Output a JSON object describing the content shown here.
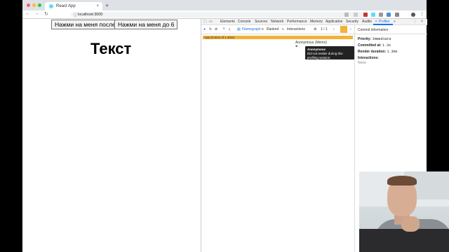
{
  "browser": {
    "tab_title": "React App",
    "tab_close": "×",
    "new_tab": "+",
    "url": "localhost:3000",
    "back": "←",
    "forward": "→",
    "reload": "↻"
  },
  "page": {
    "button_after": "Нажми на меня после",
    "button_before": "Нажми на меня до 6",
    "heading": "Текст"
  },
  "devtools": {
    "tabs": [
      "Elements",
      "Console",
      "Sources",
      "Network",
      "Performance",
      "Memory",
      "Application",
      "Security",
      "Audits",
      "⚛ Profiler"
    ],
    "more": "»",
    "close": "×",
    "toolbar": {
      "flamegraph": "Flamegraph",
      "ranked": "Ranked",
      "interactions": "Interactions",
      "commit_counter": "1 / 1",
      "prev": "‹",
      "next": "›"
    },
    "flame": {
      "app_bar": "App (0.5ms of 1.3ms)",
      "anonymous": "Anonymous (Memo)"
    },
    "tooltip": {
      "title": "Anonymous",
      "body": "Did not render during this profiling session."
    },
    "commit_info": {
      "header": "Commit information",
      "priority_label": "Priority:",
      "priority_value": "Immediate",
      "committed_label": "Committed at:",
      "committed_value": "1.3s",
      "duration_label": "Render duration:",
      "duration_value": "1.3ms",
      "interactions_label": "Interactions:",
      "interactions_value": "None"
    }
  },
  "colors": {
    "flame_bar": "#f0b33a",
    "active_tab": "#1a73e8",
    "tooltip_bg": "#222222"
  }
}
